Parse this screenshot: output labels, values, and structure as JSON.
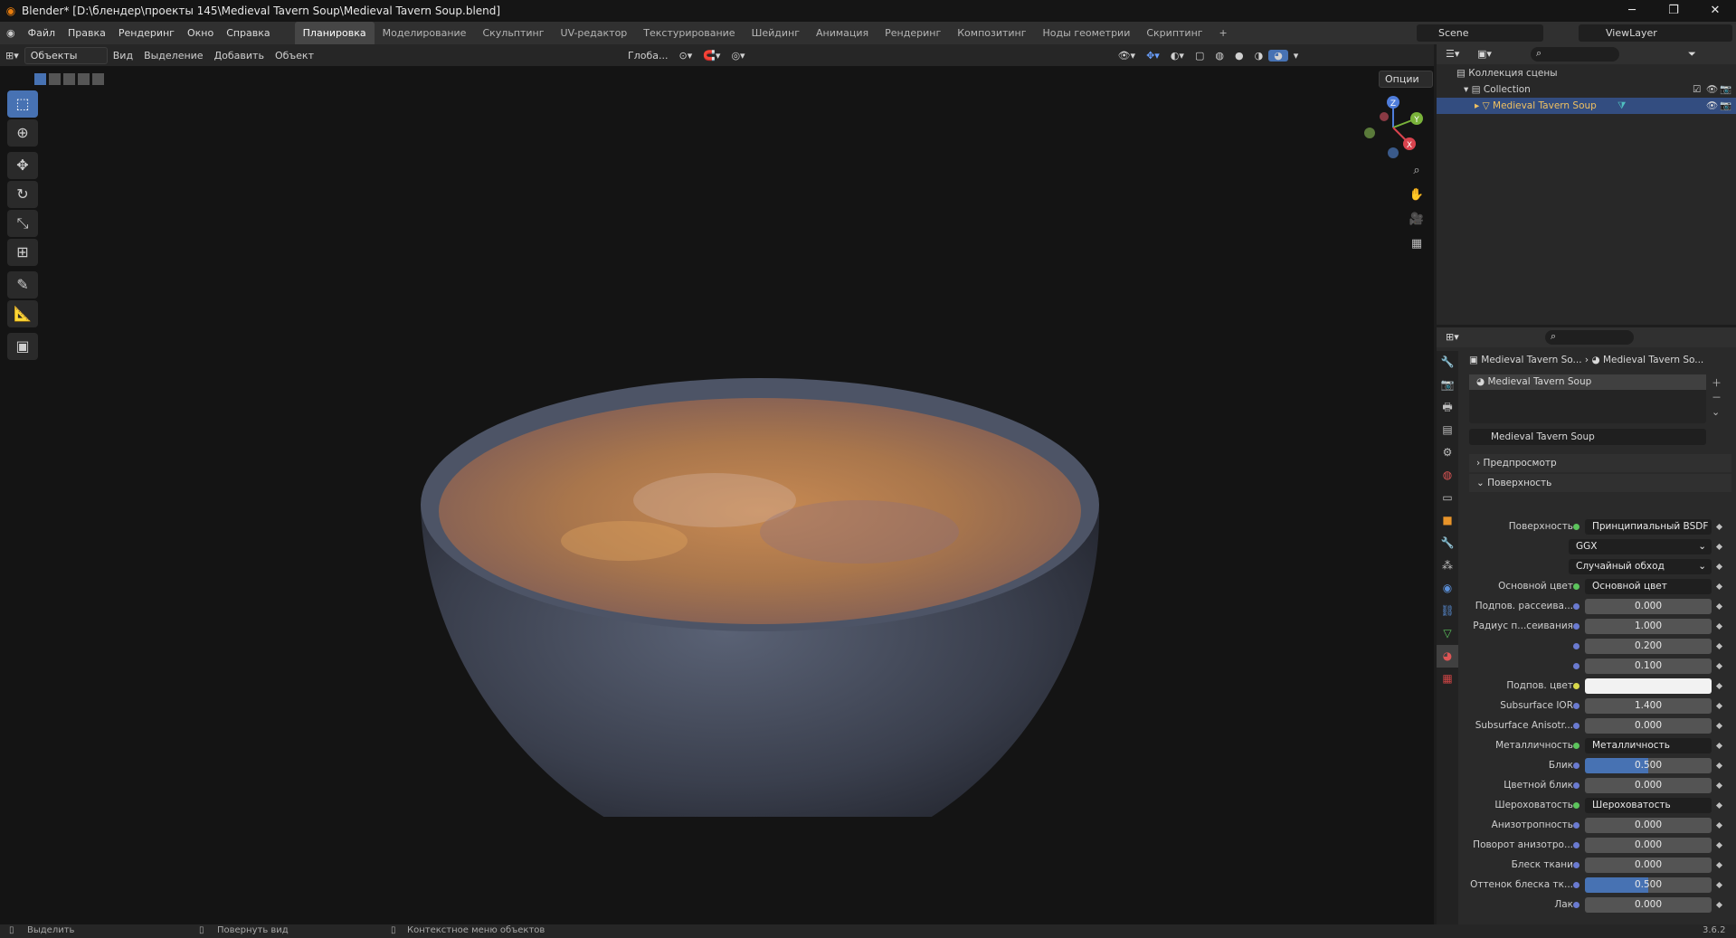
{
  "titlebar": {
    "title": "Blender* [D:\\блендер\\проекты 145\\Medieval Tavern Soup\\Medieval Tavern Soup.blend]",
    "min": "─",
    "max": "❐",
    "close": "✕"
  },
  "menus": [
    "Файл",
    "Правка",
    "Рендеринг",
    "Окно",
    "Справка"
  ],
  "workspaces": [
    "Планировка",
    "Моделирование",
    "Скульптинг",
    "UV-редактор",
    "Текстурирование",
    "Шейдинг",
    "Анимация",
    "Рендеринг",
    "Композитинг",
    "Ноды геометрии",
    "Скриптинг",
    "+"
  ],
  "scene": {
    "name": "Scene",
    "view_layer": "ViewLayer"
  },
  "vpheader": {
    "mode": "Объекты",
    "view": "Вид",
    "select": "Выделение",
    "add": "Добавить",
    "object": "Объект",
    "transform": "Глоба...",
    "options": "Опции"
  },
  "outliner": {
    "scene_collection": "Коллекция сцены",
    "collection": "Collection",
    "object": "Medieval Tavern Soup"
  },
  "props": {
    "breadcrumb_obj": "Medieval Tavern So...",
    "breadcrumb_mat": "Medieval Tavern So...",
    "slot": "Medieval Tavern Soup",
    "material": "Medieval Tavern Soup",
    "preview": "Предпросмотр",
    "surface_panel": "Поверхность",
    "rows": [
      {
        "label": "Поверхность",
        "value": "Принципиальный BSDF",
        "kind": "link"
      },
      {
        "label": "",
        "value": "GGX",
        "kind": "select"
      },
      {
        "label": "",
        "value": "Случайный обход",
        "kind": "select"
      },
      {
        "label": "Основной цвет",
        "value": "Основной цвет",
        "kind": "link"
      },
      {
        "label": "Подпов. рассеива...",
        "value": "0.000",
        "kind": "num"
      },
      {
        "label": "Радиус п...сеивания",
        "value": "1.000",
        "kind": "num"
      },
      {
        "label": "",
        "value": "0.200",
        "kind": "num"
      },
      {
        "label": "",
        "value": "0.100",
        "kind": "num"
      },
      {
        "label": "Подпов. цвет",
        "value": "",
        "kind": "color"
      },
      {
        "label": "Subsurface IOR",
        "value": "1.400",
        "kind": "num"
      },
      {
        "label": "Subsurface Anisotr...",
        "value": "0.000",
        "kind": "num"
      },
      {
        "label": "Металличность",
        "value": "Металличность",
        "kind": "link"
      },
      {
        "label": "Блик",
        "value": "0.500",
        "kind": "bar"
      },
      {
        "label": "Цветной блик",
        "value": "0.000",
        "kind": "num"
      },
      {
        "label": "Шероховатость",
        "value": "Шероховатость",
        "kind": "link"
      },
      {
        "label": "Анизотропность",
        "value": "0.000",
        "kind": "num"
      },
      {
        "label": "Поворот анизотро...",
        "value": "0.000",
        "kind": "num"
      },
      {
        "label": "Блеск ткани",
        "value": "0.000",
        "kind": "num"
      },
      {
        "label": "Оттенок блеска тк...",
        "value": "0.500",
        "kind": "bar"
      },
      {
        "label": "Лак",
        "value": "0.000",
        "kind": "num"
      }
    ]
  },
  "status": {
    "select": "Выделить",
    "rotate": "Повернуть вид",
    "context": "Контекстное меню объектов",
    "version": "3.6.2"
  },
  "gizmo": {
    "x": "X",
    "y": "Y",
    "z": "Z"
  }
}
